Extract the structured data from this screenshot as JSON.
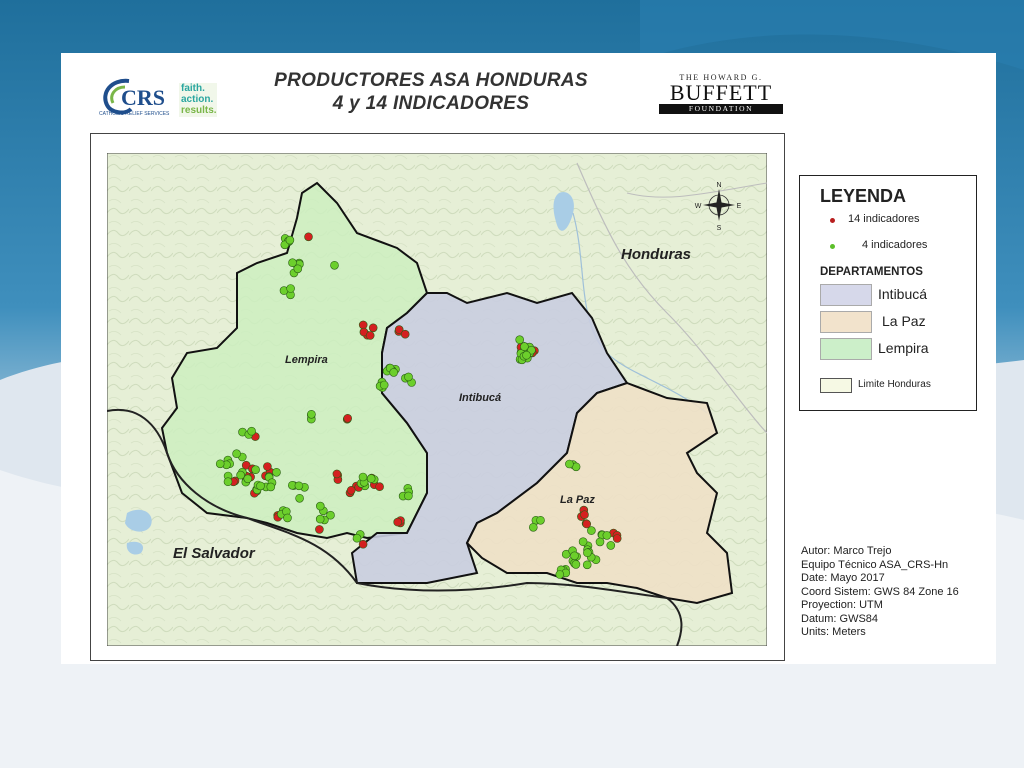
{
  "header": {
    "title_line1": "PRODUCTORES ASA HONDURAS",
    "title_line2": "4 y 14 INDICADORES"
  },
  "crs_logo": {
    "mark": "CRS",
    "tagline1": "faith.",
    "tagline2": "action.",
    "tagline3": "results.",
    "org": "CATHOLIC RELIEF SERVICES",
    "colors": {
      "blue": "#1f4e8c",
      "green": "#7ab648",
      "teal": "#2aa6a0"
    }
  },
  "buffett_logo": {
    "top": "THE HOWARD G.",
    "name": "BUFFETT",
    "foot": "FOUNDATION"
  },
  "map": {
    "labels": {
      "country_main": "Honduras",
      "country_other": "El Salvador",
      "dept_lempira": "Lempira",
      "dept_intibuca": "Intibucá",
      "dept_lapaz": "La Paz"
    },
    "compass": {
      "n": "N",
      "s": "S",
      "e": "E",
      "w": "W"
    },
    "colors": {
      "base": "#e6efd6",
      "lempira": "#cdeec0",
      "intibuca": "#c9cde0",
      "lapaz": "#eee0c6",
      "indicator_14": "#d42020",
      "indicator_4": "#6ccf2c"
    }
  },
  "legend": {
    "title": "LEYENDA",
    "item_14": "14 indicadores",
    "item_4": "4 indicadores",
    "dept_header": "DEPARTAMENTOS",
    "dept_intibuca": "Intibucá",
    "dept_lapaz": "La Paz",
    "dept_lempira": "Lempira",
    "limit": "Limite Honduras",
    "colors": {
      "intibuca": "#d6d8ea",
      "lapaz": "#f2e3cc",
      "lempira": "#ccefc9",
      "indicator_14": "#b81f1f",
      "indicator_4": "#5cbf2a"
    }
  },
  "credits": {
    "author": "Autor: Marco Trejo",
    "team": "Equipo Técnico ASA_CRS-Hn",
    "date": "Date: Mayo 2017",
    "coord": "Coord Sistem: GWS 84 Zone 16",
    "projection": "Proyection: UTM",
    "datum": "Datum: GWS84",
    "units": "Units: Meters"
  }
}
